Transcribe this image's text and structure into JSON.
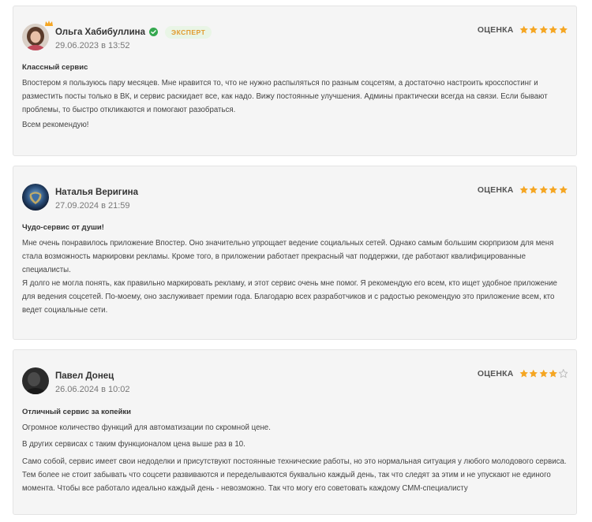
{
  "rating_label": "ОЦЕНКА",
  "colors": {
    "star": "#f5a623",
    "star_empty": "#bcbcbc",
    "verified": "#35a84f",
    "badge_text": "#e29a2d",
    "badge_bg": "#e9f5e6"
  },
  "reviews": [
    {
      "author": "Ольга Хабибуллина",
      "verified": true,
      "badge": "ЭКСПЕРТ",
      "date": "29.06.2023 в 13:52",
      "rating": 5,
      "title": "Классный сервис",
      "paragraphs": [
        "Впостером я пользуюсь пару месяцев. Мне нравится то, что не нужно распыляться по разным соцсетям, а достаточно настроить кросспостинг и разместить посты только в ВК, и сервис раскидает все, как надо. Вижу постоянные улучшения. Админы практически всегда на связи. Если бывают проблемы, то быстро откликаются и помогают разобраться.",
        "Всем рекомендую!"
      ]
    },
    {
      "author": "Наталья Веригина",
      "verified": false,
      "date": "27.09.2024 в 21:59",
      "rating": 5,
      "title": "Чудо-сервис от души!",
      "paragraphs": [
        "Мне очень понравилось приложение Впостер. Оно значительно упрощает ведение социальных сетей. Однако самым большим сюрпризом для меня стала возможность маркировки рекламы. Кроме того, в приложении работает прекрасный чат поддержки, где работают квалифицированные специалисты.",
        "Я долго не могла понять, как правильно маркировать рекламу, и этот сервис очень мне помог. Я рекомендую его всем, кто ищет удобное приложение для ведения соцсетей. По-моему, оно заслуживает премии года. Благодарю всех разработчиков и с радостью рекомендую это приложение всем, кто ведет социальные сети."
      ]
    },
    {
      "author": "Павел Донец",
      "verified": false,
      "date": "26.06.2024 в 10:02",
      "rating": 4,
      "title": "Отличный сервис за копейки",
      "paragraphs": [
        "Огромное количество функций для автоматизации по скромной цене.",
        "В других сервисах с таким функционалом цена выше раз в 10.",
        "Само собой, сервис имеет свои недоделки и присутствуют постоянные технические работы, но это нормальная ситуация у любого молодового сервиса. Тем более не стоит забывать что соцсети развиваются и переделываются буквально каждый день, так что следят за этим и не упускают не единого момента. Чтобы все работало идеально каждый день - невозможно. Так что могу его советовать каждому СММ-специалисту"
      ]
    }
  ]
}
